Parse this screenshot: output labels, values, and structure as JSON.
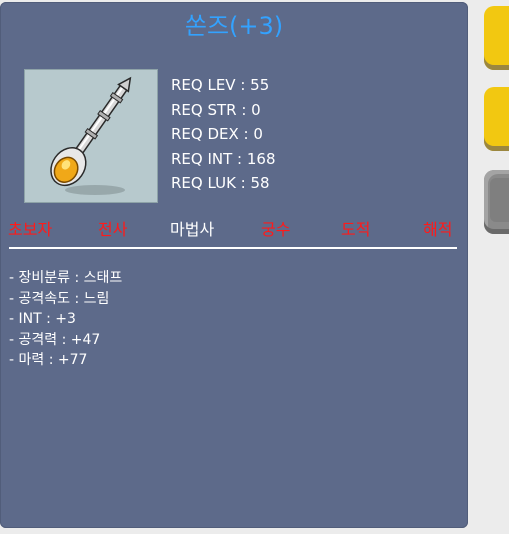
{
  "tooltip": {
    "title": "쏜즈(+3)",
    "requirements": [
      "REQ LEV : 55",
      "REQ STR : 0",
      "REQ DEX : 0",
      "REQ INT : 168",
      "REQ LUK : 58"
    ],
    "jobs": [
      {
        "label": "초보자",
        "eligible": false
      },
      {
        "label": "전사",
        "eligible": false
      },
      {
        "label": "마법사",
        "eligible": true
      },
      {
        "label": "궁수",
        "eligible": false
      },
      {
        "label": "도적",
        "eligible": false
      },
      {
        "label": "해적",
        "eligible": false
      }
    ],
    "stats": [
      "- 장비분류 : 스태프",
      "- 공격속도 : 느림",
      "- INT : +3",
      "- 공격력 : +47",
      "- 마력 : +77"
    ],
    "item_icon": "staff-icon"
  },
  "colors": {
    "panel": "#5d6a8a",
    "title": "#33a2ff",
    "ineligible_job": "#ff1a1a",
    "eligible_job": "#ffffff",
    "tab_active": "#f2c811",
    "tab_inactive": "#8a8a8a"
  }
}
